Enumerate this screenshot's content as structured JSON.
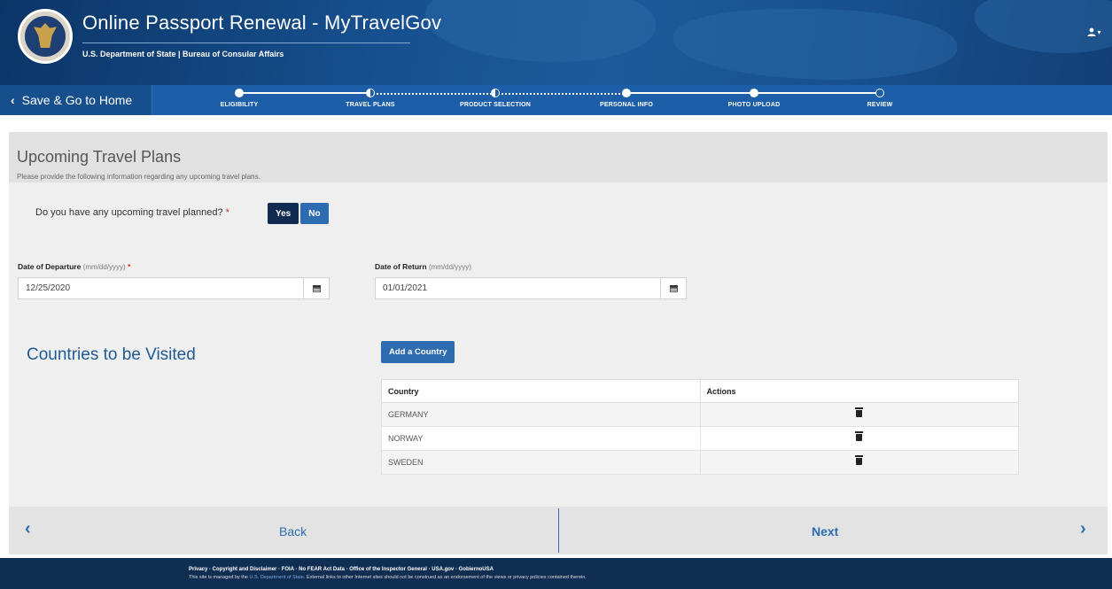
{
  "header": {
    "app_title": "Online Passport Renewal - MyTravelGov",
    "subtitle": "U.S. Department of State | Bureau of Consular Affairs",
    "user_menu_label": "▾"
  },
  "nav": {
    "save_home_label": "Save & Go to Home",
    "steps": [
      {
        "label": "ELIGIBILITY",
        "state": "complete"
      },
      {
        "label": "TRAVEL PLANS",
        "state": "current"
      },
      {
        "label": "PRODUCT SELECTION",
        "state": "partial"
      },
      {
        "label": "PERSONAL INFO",
        "state": "complete"
      },
      {
        "label": "PHOTO UPLOAD",
        "state": "complete"
      },
      {
        "label": "REVIEW",
        "state": "pending"
      }
    ]
  },
  "page": {
    "title": "Upcoming Travel Plans",
    "description": "Please provide the following information regarding any upcoming travel plans."
  },
  "travel_question": {
    "text": "Do you have any upcoming travel planned?",
    "required_mark": "*",
    "yes_label": "Yes",
    "no_label": "No",
    "selected": "Yes"
  },
  "departure": {
    "label": "Date of Departure",
    "hint": "(mm/dd/yyyy)",
    "required_mark": "*",
    "value": "12/25/2020"
  },
  "return": {
    "label": "Date of Return",
    "hint": "(mm/dd/yyyy)",
    "value": "01/01/2021"
  },
  "countries": {
    "heading": "Countries to be Visited",
    "add_label": "Add a Country",
    "columns": [
      "Country",
      "Actions"
    ],
    "rows": [
      "GERMANY",
      "NORWAY",
      "SWEDEN"
    ]
  },
  "bottom_nav": {
    "back_label": "Back",
    "next_label": "Next",
    "back_arrow": "‹",
    "next_arrow": "›"
  },
  "footer": {
    "links": "Privacy · Copyright and Disclaimer · FOIA · No FEAR Act Data · Office of the Inspector General · USA.gov · GobiernoUSA",
    "note_prefix": "This site is managed by the",
    "note_link": "U.S. Department of State",
    "note_suffix": ". External links to other Internet sites should not be construed as an endorsement of the views or privacy policies contained therein."
  },
  "colors": {
    "primary": "#2d6cb0",
    "header_dark": "#0b3567",
    "nav_blue": "#1c5ea7",
    "required": "#d12c2c",
    "footer": "#0f2e52"
  }
}
